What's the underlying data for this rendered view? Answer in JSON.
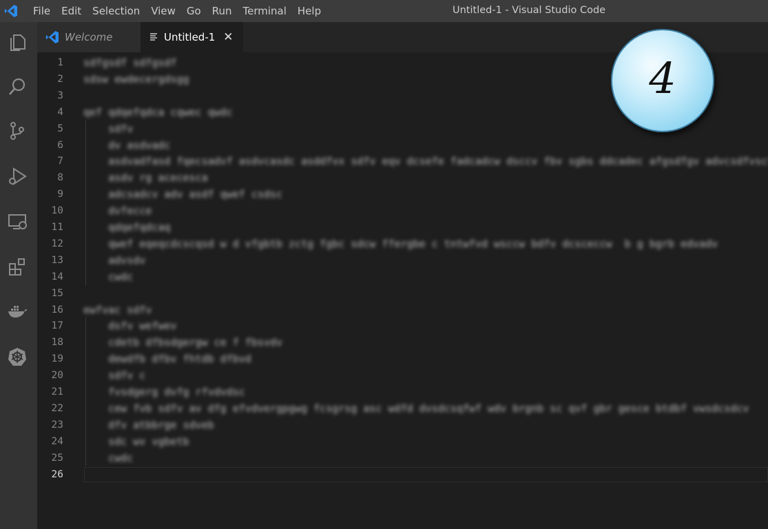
{
  "titlebar": {
    "menu": [
      "File",
      "Edit",
      "Selection",
      "View",
      "Go",
      "Run",
      "Terminal",
      "Help"
    ],
    "window_title": "Untitled-1 - Visual Studio Code",
    "logo_icon": "vscode-logo-icon",
    "accent": "#2b8cf0"
  },
  "activity_bar": {
    "icons": [
      "explorer-icon",
      "search-icon",
      "source-control-icon",
      "run-debug-icon",
      "remote-explorer-icon",
      "extensions-icon",
      "docker-icon",
      "kubernetes-icon"
    ]
  },
  "tabs": [
    {
      "label": "Welcome",
      "icon": "vscode-logo-icon",
      "active": false
    },
    {
      "label": "Untitled-1",
      "icon": "text-file-icon",
      "active": true,
      "close": "✕"
    }
  ],
  "editor": {
    "lines": [
      {
        "n": "1",
        "text": "sdfgsdf sdfgsdf"
      },
      {
        "n": "2",
        "text": "sdsw ewdecergdsgg"
      },
      {
        "n": "3",
        "text": ""
      },
      {
        "n": "4",
        "text": "qef qdqefqdca cqwec qwdc"
      },
      {
        "n": "5",
        "text": "    sdfv"
      },
      {
        "n": "6",
        "text": "    dv asdvadc"
      },
      {
        "n": "7",
        "text": "    asdvadfasd fqecsadvf asdvcasdc asddfvx sdfv eqv dcsefe fadcadcw dsccv fbv sgbs ddcadec afgsdfgv advcsdfvscf"
      },
      {
        "n": "8",
        "text": "    asdv rg acecesca"
      },
      {
        "n": "9",
        "text": "    adcsadcv adv asdf qwef csdsc"
      },
      {
        "n": "10",
        "text": "    dvfecce"
      },
      {
        "n": "11",
        "text": "    qdqefqdcaq"
      },
      {
        "n": "12",
        "text": "    qwef eqeqcdcscqsd w d vfgbtb zctg fgbc sdcw ffergbe c tntwfvd wsccw bdfv dcsceccw  b g bgrb edvadv"
      },
      {
        "n": "13",
        "text": "    advsdv"
      },
      {
        "n": "14",
        "text": "    cwdc"
      },
      {
        "n": "15",
        "text": ""
      },
      {
        "n": "16",
        "text": "ewfvac sdfv"
      },
      {
        "n": "17",
        "text": "    dsfv wefwev"
      },
      {
        "n": "18",
        "text": "    cdetb dfbsdgergw ce f fbsvdv"
      },
      {
        "n": "19",
        "text": "    dewdfb dfbv fhtdb dfbvd"
      },
      {
        "n": "20",
        "text": "    sdfv c"
      },
      {
        "n": "21",
        "text": "    fvsdgerg dvfg rfvdvdsc"
      },
      {
        "n": "22",
        "text": "    cew fvb sdfv av dfg efvdvergpgwg fcsgrsg asc wdfd dvsdcsqfwf wdv brgnb sc qvf gbr gesce btdbf vwsdcsdcv"
      },
      {
        "n": "23",
        "text": "    dfv atbbrge sdveb"
      },
      {
        "n": "24",
        "text": "    sdc wv vgbetb"
      },
      {
        "n": "25",
        "text": "    cwdc"
      },
      {
        "n": "26",
        "text": ""
      }
    ],
    "active_line": "26"
  },
  "step_badge": {
    "number": "4"
  }
}
